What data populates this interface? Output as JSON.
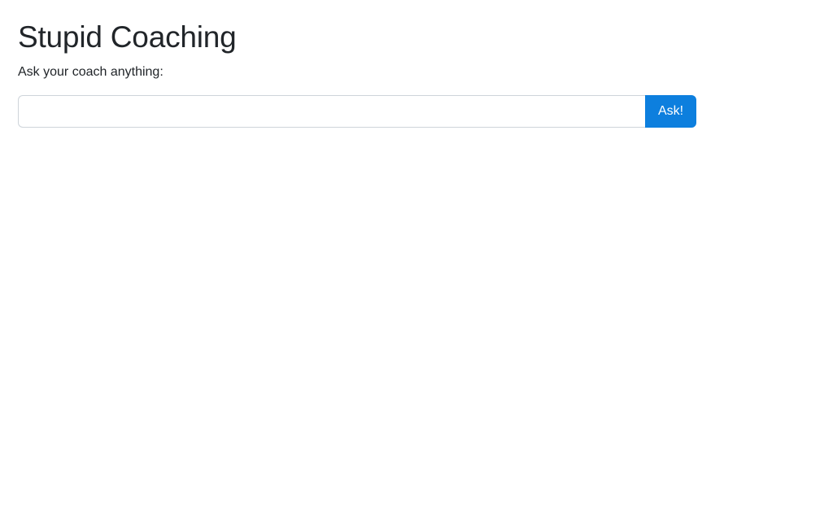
{
  "header": {
    "title": "Stupid Coaching"
  },
  "form": {
    "label": "Ask your coach anything:",
    "input_value": "",
    "input_placeholder": "",
    "submit_label": "Ask!"
  },
  "colors": {
    "accent": "#0d7fde",
    "text": "#212529",
    "input_border": "#ced4da",
    "background": "#ffffff"
  }
}
